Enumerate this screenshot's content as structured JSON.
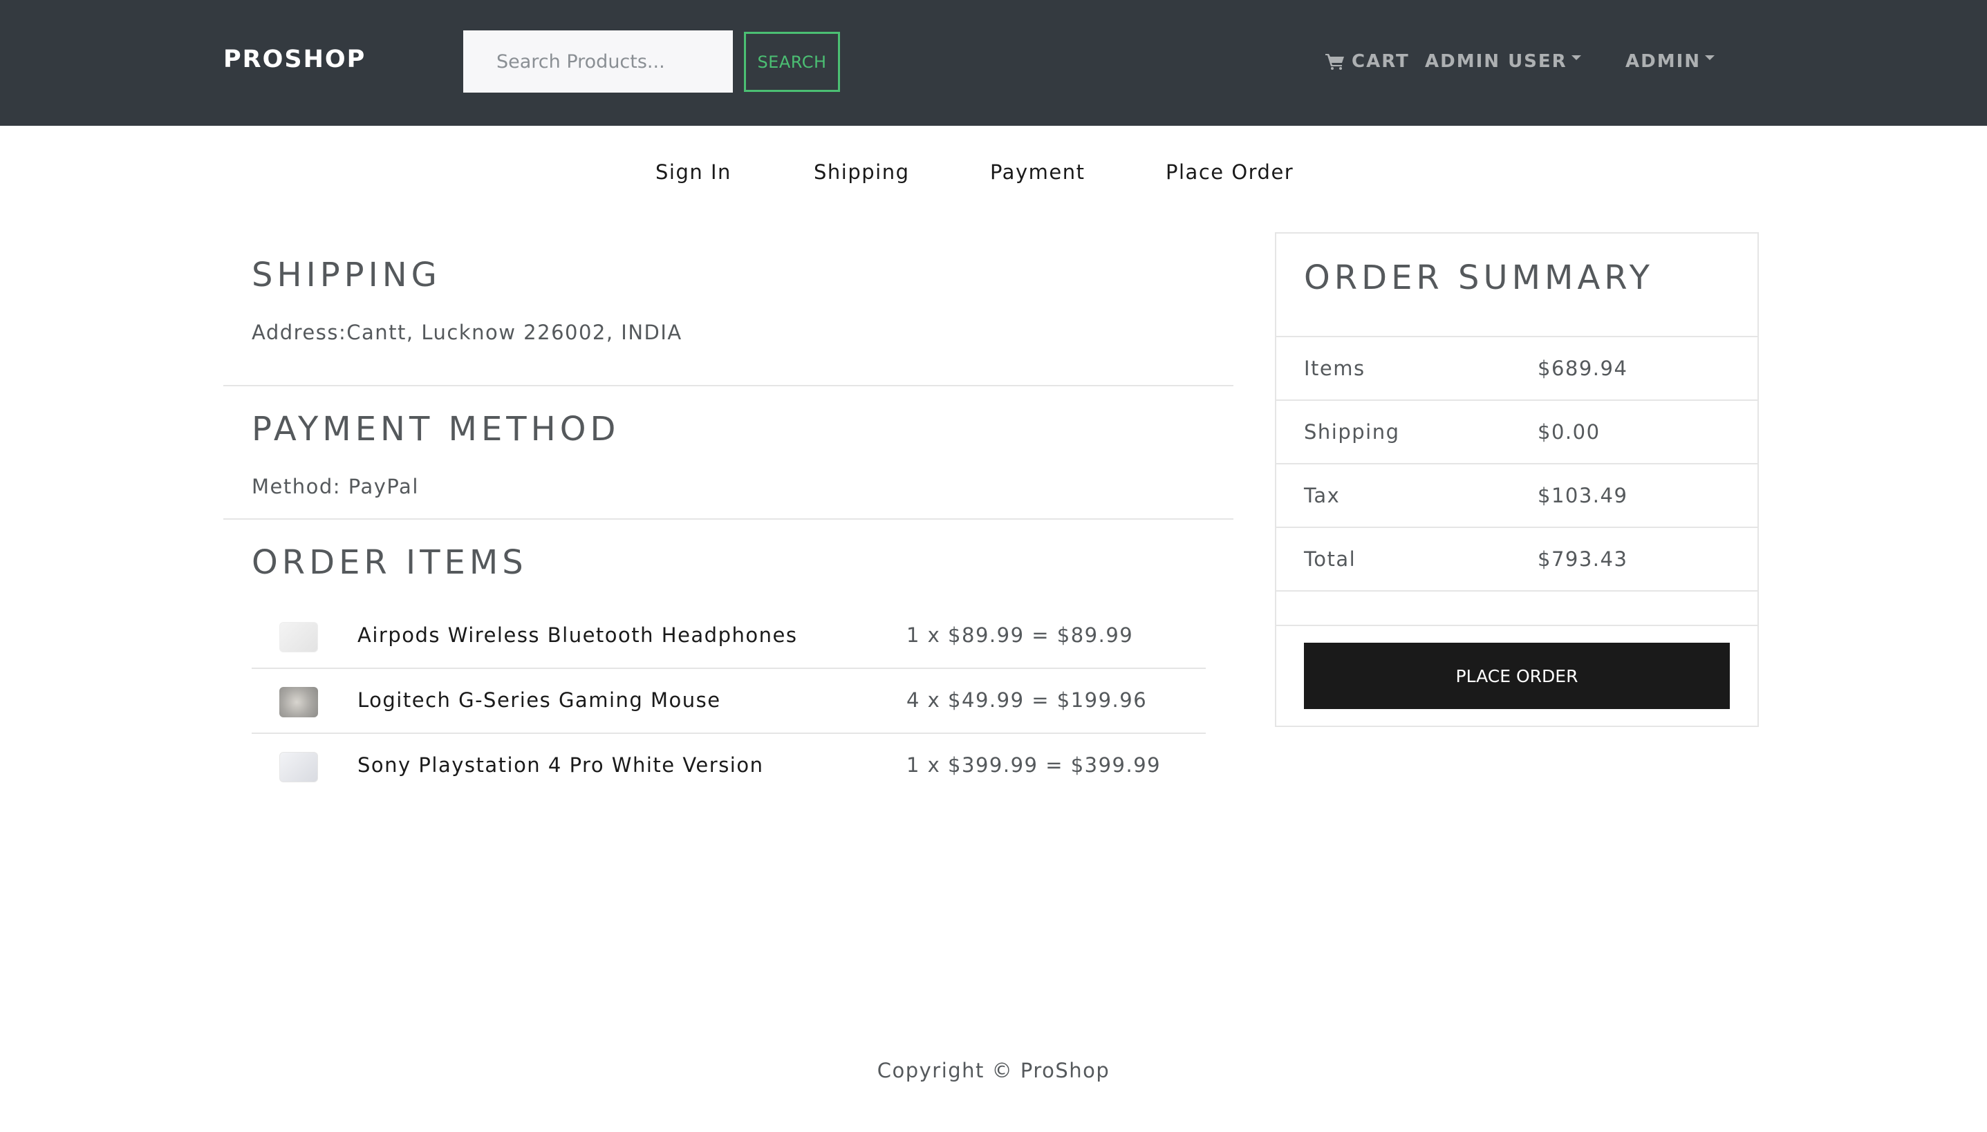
{
  "header": {
    "brand": "PROSHOP",
    "search_placeholder": "Search Products...",
    "search_button": "SEARCH",
    "cart_label": "CART",
    "user_menu_label": "ADMIN USER",
    "admin_menu_label": "ADMIN"
  },
  "steps": [
    "Sign In",
    "Shipping",
    "Payment",
    "Place Order"
  ],
  "shipping": {
    "heading": "SHIPPING",
    "address": "Address:Cantt, Lucknow 226002, INDIA"
  },
  "payment": {
    "heading": "PAYMENT METHOD",
    "method": "Method: PayPal"
  },
  "order_items": {
    "heading": "ORDER ITEMS",
    "items": [
      {
        "name": "Airpods Wireless Bluetooth Headphones",
        "price_line": "1 x $89.99 = $89.99"
      },
      {
        "name": "Logitech G-Series Gaming Mouse",
        "price_line": "4 x $49.99 = $199.96"
      },
      {
        "name": "Sony Playstation 4 Pro White Version",
        "price_line": "1 x $399.99 = $399.99"
      }
    ]
  },
  "summary": {
    "title": "ORDER SUMMARY",
    "rows": [
      {
        "label": "Items",
        "value": "$689.94"
      },
      {
        "label": "Shipping",
        "value": "$0.00"
      },
      {
        "label": "Tax",
        "value": "$103.49"
      },
      {
        "label": "Total",
        "value": "$793.43"
      }
    ],
    "place_order_button": "PLACE ORDER"
  },
  "footer": {
    "copyright": "Copyright © ProShop"
  },
  "colors": {
    "navbar_bg": "#343a40",
    "accent_green": "#4bbf73",
    "button_dark": "#1a1a1a",
    "text": "#55595c"
  },
  "icons": {
    "cart": "shopping-cart-icon"
  }
}
